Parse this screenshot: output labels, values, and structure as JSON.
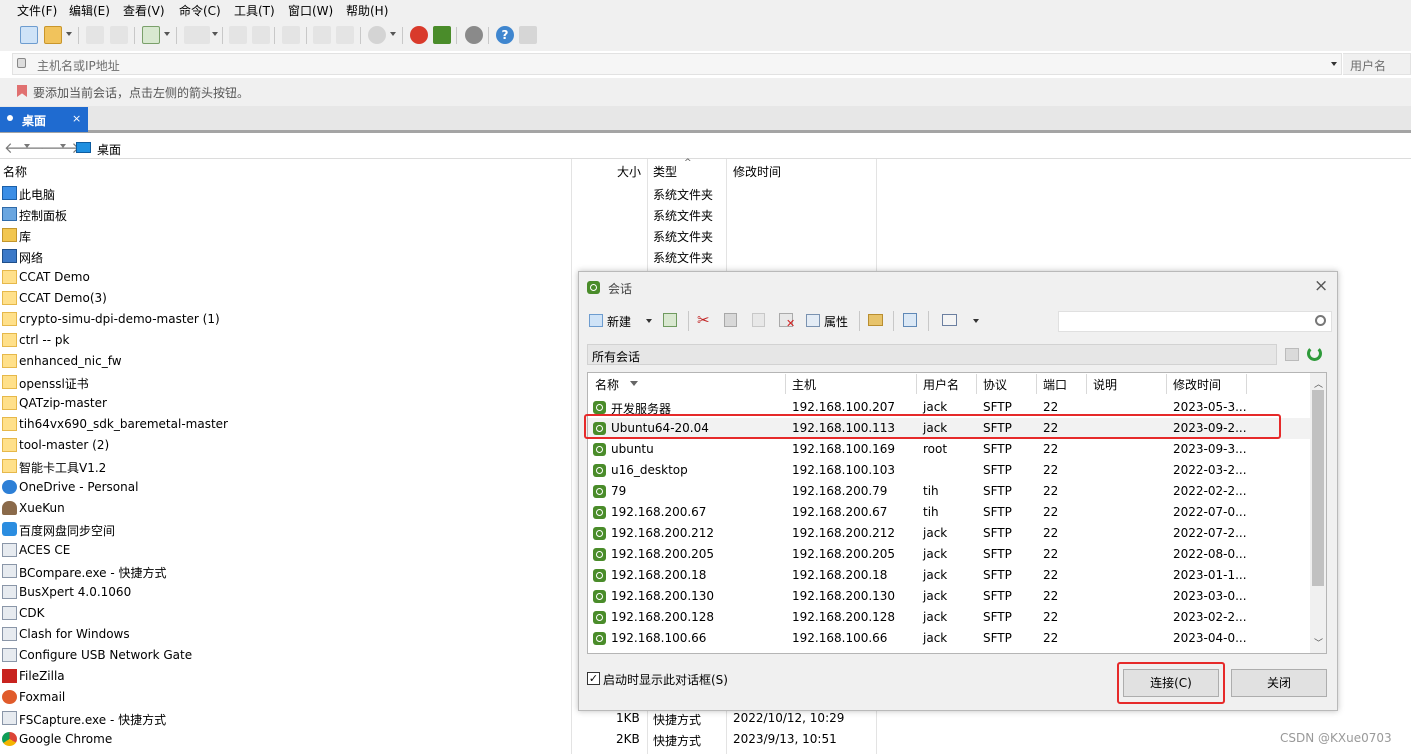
{
  "menu": [
    "文件(F)",
    "编辑(E)",
    "查看(V)",
    "命令(C)",
    "工具(T)",
    "窗口(W)",
    "帮助(H)"
  ],
  "address": {
    "placeholder": "主机名或IP地址",
    "user_placeholder": "用户名"
  },
  "hint": "要添加当前会话，点击左侧的箭头按钮。",
  "tab": {
    "label": "桌面",
    "close": "×"
  },
  "nav": {
    "location": "桌面"
  },
  "explorer": {
    "headers": {
      "name": "名称",
      "size": "大小",
      "type": "类型",
      "modified": "修改时间"
    },
    "items": [
      {
        "name": "此电脑",
        "icon": "computer-icon",
        "type": "系统文件夹"
      },
      {
        "name": "控制面板",
        "icon": "control-panel-icon",
        "type": "系统文件夹"
      },
      {
        "name": "库",
        "icon": "library-icon",
        "type": "系统文件夹"
      },
      {
        "name": "网络",
        "icon": "network-icon",
        "type": "系统文件夹"
      },
      {
        "name": "CCAT Demo",
        "icon": "folder-icon"
      },
      {
        "name": "CCAT Demo(3)",
        "icon": "folder-icon"
      },
      {
        "name": "crypto-simu-dpi-demo-master (1)",
        "icon": "folder-icon"
      },
      {
        "name": "ctrl -- pk",
        "icon": "folder-icon"
      },
      {
        "name": "enhanced_nic_fw",
        "icon": "folder-icon"
      },
      {
        "name": "openssl证书",
        "icon": "folder-icon"
      },
      {
        "name": "QATzip-master",
        "icon": "folder-icon"
      },
      {
        "name": "tih64vx690_sdk_baremetal-master",
        "icon": "folder-icon"
      },
      {
        "name": "tool-master (2)",
        "icon": "folder-icon"
      },
      {
        "name": "智能卡工具V1.2",
        "icon": "folder-icon"
      },
      {
        "name": "OneDrive - Personal",
        "icon": "onedrive-icon"
      },
      {
        "name": "XueKun",
        "icon": "user-icon"
      },
      {
        "name": "百度网盘同步空间",
        "icon": "baidu-netdisk-icon"
      },
      {
        "name": "ACES CE",
        "icon": "app-icon"
      },
      {
        "name": "BCompare.exe - 快捷方式",
        "icon": "app-icon"
      },
      {
        "name": "BusXpert 4.0.1060",
        "icon": "app-icon"
      },
      {
        "name": "CDK",
        "icon": "app-icon"
      },
      {
        "name": "Clash for Windows",
        "icon": "app-icon"
      },
      {
        "name": "Configure USB Network Gate",
        "icon": "app-icon"
      },
      {
        "name": "FileZilla",
        "icon": "filezilla-icon"
      },
      {
        "name": "Foxmail",
        "icon": "foxmail-icon"
      },
      {
        "name": "FSCapture.exe - 快捷方式",
        "icon": "app-icon",
        "size": "1KB",
        "type": "快捷方式",
        "modified": "2022/10/12, 10:29"
      },
      {
        "name": "Google Chrome",
        "icon": "chrome-icon",
        "size": "2KB",
        "type": "快捷方式",
        "modified": "2023/9/13, 10:51"
      }
    ]
  },
  "dialog": {
    "title": "会话",
    "close": "×",
    "toolbar": {
      "new_label": "新建",
      "props_label": "属性"
    },
    "folder_label": "所有会话",
    "headers": [
      "名称",
      "主机",
      "用户名",
      "协议",
      "端口",
      "说明",
      "修改时间"
    ],
    "sessions": [
      [
        "开发服务器",
        "192.168.100.207",
        "jack",
        "SFTP",
        "22",
        "",
        "2023-05-3..."
      ],
      [
        "Ubuntu64-20.04",
        "192.168.100.113",
        "jack",
        "SFTP",
        "22",
        "",
        "2023-09-2..."
      ],
      [
        "ubuntu",
        "192.168.100.169",
        "root",
        "SFTP",
        "22",
        "",
        "2023-09-3..."
      ],
      [
        "u16_desktop",
        "192.168.100.103",
        "",
        "SFTP",
        "22",
        "",
        "2022-03-2..."
      ],
      [
        "79",
        "192.168.200.79",
        "tih",
        "SFTP",
        "22",
        "",
        "2022-02-2..."
      ],
      [
        "192.168.200.67",
        "192.168.200.67",
        "tih",
        "SFTP",
        "22",
        "",
        "2022-07-0..."
      ],
      [
        "192.168.200.212",
        "192.168.200.212",
        "jack",
        "SFTP",
        "22",
        "",
        "2022-07-2..."
      ],
      [
        "192.168.200.205",
        "192.168.200.205",
        "jack",
        "SFTP",
        "22",
        "",
        "2022-08-0..."
      ],
      [
        "192.168.200.18",
        "192.168.200.18",
        "jack",
        "SFTP",
        "22",
        "",
        "2023-01-1..."
      ],
      [
        "192.168.200.130",
        "192.168.200.130",
        "jack",
        "SFTP",
        "22",
        "",
        "2023-03-0..."
      ],
      [
        "192.168.200.128",
        "192.168.200.128",
        "jack",
        "SFTP",
        "22",
        "",
        "2023-02-2..."
      ],
      [
        "192.168.100.66",
        "192.168.100.66",
        "jack",
        "SFTP",
        "22",
        "",
        "2023-04-0..."
      ]
    ],
    "selected_index": 1,
    "startup_checkbox": {
      "label": "启动时显示此对话框(S)",
      "checked": true
    },
    "connect_label": "连接(C)",
    "close_label": "关闭"
  },
  "watermark": "CSDN @KXue0703",
  "colors": {
    "tab_accent": "#1f6bd0",
    "highlight_box": "#e62a2a",
    "session_icon": "#4a8c2a"
  }
}
